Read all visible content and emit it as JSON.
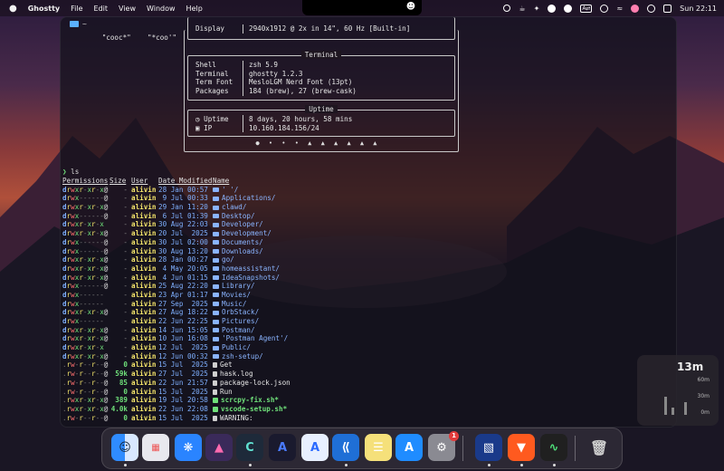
{
  "menubar": {
    "app_name": "Ghostty",
    "menus": [
      "File",
      "Edit",
      "View",
      "Window",
      "Help"
    ],
    "clock": "Sun 22:11"
  },
  "terminal": {
    "title": "~",
    "cooc_line": "   \"cooc*\"    \"*coo'\"",
    "display": {
      "key": "Display",
      "value": "2940x1912 @ 2x in 14\", 60 Hz [Built-in]"
    },
    "terminal_box": {
      "title": "Terminal",
      "rows": [
        {
          "key": "Shell",
          "value": "zsh 5.9"
        },
        {
          "key": "Terminal",
          "value": "ghostty 1.2.3"
        },
        {
          "key": "Term Font",
          "value": "MesloLGM Nerd Font (13pt)"
        },
        {
          "key": "Packages",
          "value": "184 (brew), 27 (brew-cask)"
        }
      ]
    },
    "uptime_box": {
      "title": "Uptime",
      "rows": [
        {
          "key": "◷ Uptime",
          "value": "8 days, 20 hours, 58 mins"
        },
        {
          "key": "▣ IP",
          "value": "10.160.184.156/24"
        }
      ]
    },
    "dots": "● • • • ▲ ▲ ▲ ▲ ▲ ▲",
    "prompt_arrow": "❯",
    "prompt_cmd": "ls",
    "headers": [
      "Permissions",
      "Size",
      "User",
      "Date Modified",
      "Name"
    ],
    "rows": [
      {
        "perm": "drwxr-xr-x@",
        "size": "-",
        "user": "alivin",
        "date": "28 Jan 00:57",
        "name": "' '/",
        "type": "dir"
      },
      {
        "perm": "drwx------@",
        "size": "-",
        "user": "alivin",
        "date": " 9 Jul 00:33",
        "name": "Applications/",
        "type": "dir"
      },
      {
        "perm": "drwxr-xr-x@",
        "size": "-",
        "user": "alivin",
        "date": "29 Jan 11:20",
        "name": "clawd/",
        "type": "dir"
      },
      {
        "perm": "drwx------@",
        "size": "-",
        "user": "alivin",
        "date": " 6 Jul 01:39",
        "name": "Desktop/",
        "type": "dir"
      },
      {
        "perm": "drwxr-xr-x ",
        "size": "-",
        "user": "alivin",
        "date": "30 Aug 22:03",
        "name": "Developer/",
        "type": "dir"
      },
      {
        "perm": "drwxr-xr-x@",
        "size": "-",
        "user": "alivin",
        "date": "20 Jul  2025",
        "name": "Development/",
        "type": "dir"
      },
      {
        "perm": "drwx------@",
        "size": "-",
        "user": "alivin",
        "date": "30 Jul 02:00",
        "name": "Documents/",
        "type": "dir"
      },
      {
        "perm": "drwx------@",
        "size": "-",
        "user": "alivin",
        "date": "30 Aug 13:20",
        "name": "Downloads/",
        "type": "dir"
      },
      {
        "perm": "drwxr-xr-x@",
        "size": "-",
        "user": "alivin",
        "date": "28 Jan 00:27",
        "name": "go/",
        "type": "dir"
      },
      {
        "perm": "drwxr-xr-x@",
        "size": "-",
        "user": "alivin",
        "date": " 4 May 20:05",
        "name": "homeassistant/",
        "type": "dir"
      },
      {
        "perm": "drwxr-xr-x@",
        "size": "-",
        "user": "alivin",
        "date": " 4 Jun 01:15",
        "name": "IdeaSnapshots/",
        "type": "dir"
      },
      {
        "perm": "drwx------@",
        "size": "-",
        "user": "alivin",
        "date": "25 Aug 22:20",
        "name": "Library/",
        "type": "dir"
      },
      {
        "perm": "drwx------ ",
        "size": "-",
        "user": "alivin",
        "date": "23 Apr 01:17",
        "name": "Movies/",
        "type": "dir"
      },
      {
        "perm": "drwx------ ",
        "size": "-",
        "user": "alivin",
        "date": "27 Sep  2025",
        "name": "Music/",
        "type": "dir"
      },
      {
        "perm": "drwxr-xr-x@",
        "size": "-",
        "user": "alivin",
        "date": "27 Aug 18:22",
        "name": "OrbStack/",
        "type": "dir"
      },
      {
        "perm": "drwx------ ",
        "size": "-",
        "user": "alivin",
        "date": "22 Jun 22:25",
        "name": "Pictures/",
        "type": "dir"
      },
      {
        "perm": "drwxr-xr-x@",
        "size": "-",
        "user": "alivin",
        "date": "14 Jun 15:05",
        "name": "Postman/",
        "type": "dir"
      },
      {
        "perm": "drwxr-xr-x@",
        "size": "-",
        "user": "alivin",
        "date": "10 Jun 16:08",
        "name": "'Postman Agent'/",
        "type": "dir"
      },
      {
        "perm": "drwxr-xr-x ",
        "size": "-",
        "user": "alivin",
        "date": "12 Jul  2025",
        "name": "Public/",
        "type": "dir"
      },
      {
        "perm": "drwxr-xr-x@",
        "size": "-",
        "user": "alivin",
        "date": "12 Jun 00:32",
        "name": "zsh-setup/",
        "type": "dir"
      },
      {
        "perm": ".rw-r--r--@",
        "size": "0",
        "user": "alivin",
        "date": "15 Jul  2025",
        "name": "Get",
        "type": "file"
      },
      {
        "perm": ".rw-r--r--@",
        "size": "59k",
        "user": "alivin",
        "date": "27 Jul  2025",
        "name": "hask.log",
        "type": "file"
      },
      {
        "perm": ".rw-r--r--@",
        "size": "85",
        "user": "alivin",
        "date": "22 Jun 21:57",
        "name": "package-lock.json",
        "type": "file"
      },
      {
        "perm": ".rw-r--r--@",
        "size": "0",
        "user": "alivin",
        "date": "15 Jul  2025",
        "name": "Run",
        "type": "file"
      },
      {
        "perm": ".rwxr-xr-x@",
        "size": "389",
        "user": "alivin",
        "date": "19 Jul 20:58",
        "name": "scrcpy-fix.sh*",
        "type": "exec"
      },
      {
        "perm": ".rwxr-xr-x@",
        "size": "4.0k",
        "user": "alivin",
        "date": "22 Jun 22:08",
        "name": "vscode-setup.sh*",
        "type": "exec"
      },
      {
        "perm": ".rw-r--r--@",
        "size": "0",
        "user": "alivin",
        "date": "15 Jul  2025",
        "name": "WARNING:",
        "type": "file"
      }
    ]
  },
  "widget": {
    "value": "13m",
    "labels": [
      "60m",
      "30m",
      "0m"
    ]
  },
  "dock": {
    "badge_count": "1"
  }
}
